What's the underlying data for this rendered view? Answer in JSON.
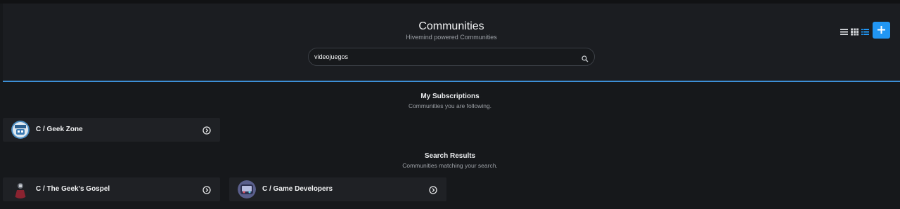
{
  "header": {
    "title": "Communities",
    "subtitle": "Hivemind powered Communities"
  },
  "search": {
    "value": "videojuegos",
    "placeholder": "Search"
  },
  "view_modes": [
    "list-view-icon",
    "grid-view-icon",
    "compact-list-icon"
  ],
  "colors": {
    "accent": "#2196f3",
    "header_border": "#3d8fd6",
    "background": "#16181b",
    "card": "#1f2125"
  },
  "subscriptions": {
    "title": "My Subscriptions",
    "subtitle": "Communities you are following.",
    "items": [
      {
        "name": "C / Geek Zone",
        "icon": "geek-zone-avatar"
      }
    ]
  },
  "search_results": {
    "title": "Search Results",
    "subtitle": "Communities matching your search.",
    "items": [
      {
        "name": "C / The Geek's Gospel",
        "icon": "geeks-gospel-avatar"
      },
      {
        "name": "C / Game Developers",
        "icon": "game-developers-avatar"
      }
    ]
  }
}
